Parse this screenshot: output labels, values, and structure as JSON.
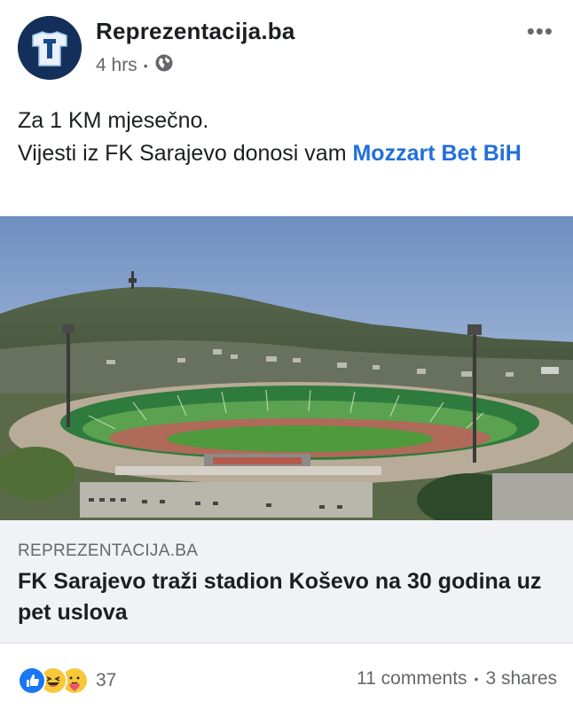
{
  "post": {
    "page_name": "Reprezentacija.ba",
    "time": "4 hrs",
    "privacy_icon": "globe-icon",
    "more_icon": "more-options-icon",
    "text_line1": "Za 1 KM mjesečno.",
    "text_line2_prefix": "Vijesti iz FK Sarajevo donosi vam ",
    "text_link": "Mozzart Bet BiH"
  },
  "link_card": {
    "domain": "REPREZENTACIJA.BA",
    "headline": "FK Sarajevo traži stadion Koševo na 30 godina uz pet uslova"
  },
  "footer": {
    "reaction_icons": [
      "like-icon",
      "haha-icon",
      "care-icon"
    ],
    "reaction_count": "37",
    "comments": "11 comments",
    "shares": "3 shares"
  },
  "colors": {
    "link": "#216fdb",
    "secondary_text": "#65676b",
    "card_bg": "#f0f2f5",
    "like_blue": "#1877f2"
  }
}
